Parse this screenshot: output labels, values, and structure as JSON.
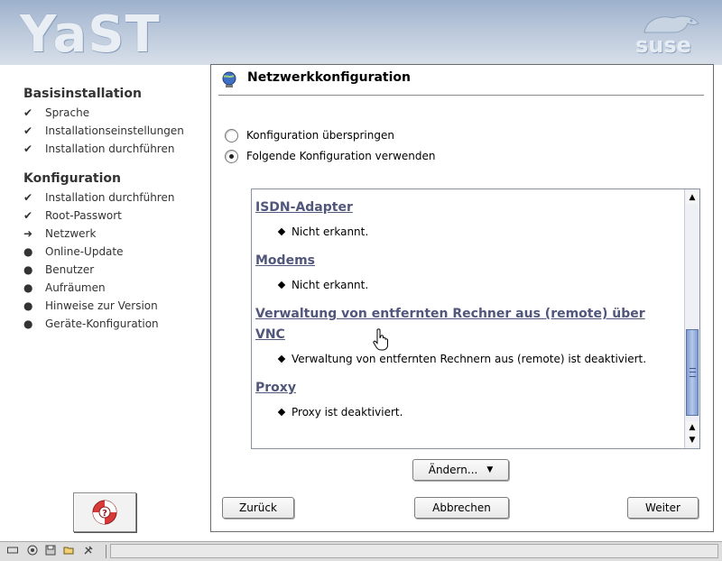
{
  "header": {
    "logo": "YaST",
    "brand": "suse"
  },
  "sidebar": {
    "sections": [
      {
        "title": "Basisinstallation",
        "items": [
          {
            "label": "Sprache",
            "status": "done"
          },
          {
            "label": "Installationseinstellungen",
            "status": "done"
          },
          {
            "label": "Installation durchführen",
            "status": "done"
          }
        ]
      },
      {
        "title": "Konfiguration",
        "items": [
          {
            "label": "Installation durchführen",
            "status": "done"
          },
          {
            "label": "Root-Passwort",
            "status": "done"
          },
          {
            "label": "Netzwerk",
            "status": "current"
          },
          {
            "label": "Online-Update",
            "status": "pending"
          },
          {
            "label": "Benutzer",
            "status": "pending"
          },
          {
            "label": "Aufräumen",
            "status": "pending"
          },
          {
            "label": "Hinweise zur Version",
            "status": "pending"
          },
          {
            "label": "Geräte-Konfiguration",
            "status": "pending"
          }
        ]
      }
    ],
    "status_icons": {
      "done": "checkmark-icon",
      "current": "arrow-right-icon",
      "pending": "bullet-icon"
    },
    "help_icon": "lifebuoy-help-icon"
  },
  "main": {
    "title": "Netzwerkkonfiguration",
    "title_icon": "network-globe-icon",
    "options": [
      {
        "label": "Konfiguration überspringen",
        "checked": false
      },
      {
        "label": "Folgende Konfiguration verwenden",
        "checked": true
      }
    ],
    "summary": [
      {
        "heading": "ISDN-Adapter",
        "items": [
          "Nicht erkannt."
        ]
      },
      {
        "heading": "Modems",
        "items": [
          "Nicht erkannt."
        ]
      },
      {
        "heading": "Verwaltung von entfernten Rechner aus (remote) über VNC",
        "items": [
          "Verwaltung von entfernten Rechnern aus (remote) ist deaktiviert."
        ]
      },
      {
        "heading": "Proxy",
        "items": [
          "Proxy ist deaktiviert."
        ]
      }
    ],
    "change_button": "Ändern...",
    "back_button": "Zurück",
    "abort_button": "Abbrechen",
    "next_button": "Weiter"
  },
  "colors": {
    "link": "#51567b",
    "header_top": "#9db1cc",
    "scroll_thumb": "#7d9ad2"
  }
}
